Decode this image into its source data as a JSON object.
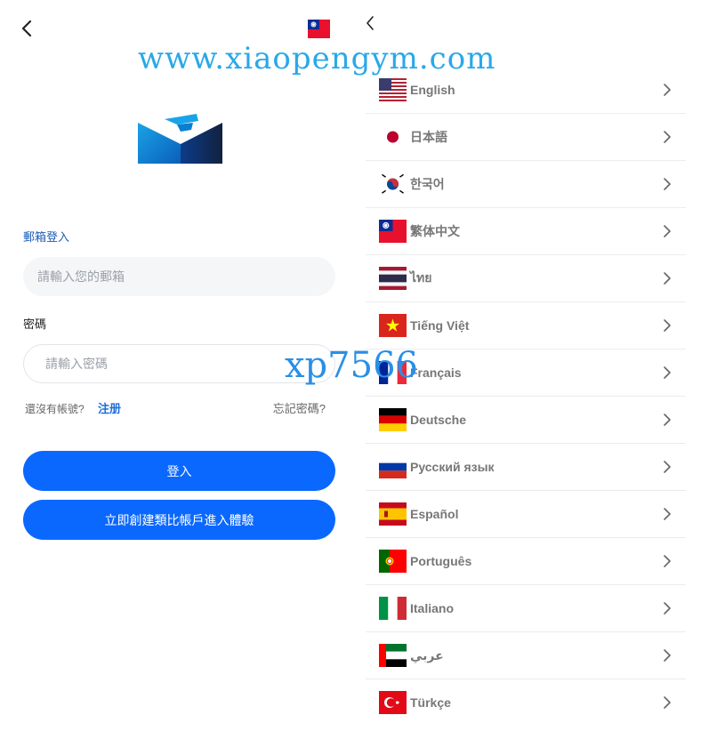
{
  "login": {
    "email_tab_label": "郵箱登入",
    "email_placeholder": "請輸入您的郵箱",
    "email_value": "",
    "password_label": "密碼",
    "password_placeholder": "請輸入密碼",
    "password_value": "",
    "no_account_text": "還沒有帳號?",
    "register_link": "注册",
    "forgot_link": "忘記密碼?",
    "login_button": "登入",
    "demo_button": "立即創建類比帳戶進入體驗",
    "current_flag": "taiwan-flag"
  },
  "languages": {
    "items": [
      {
        "label": "English",
        "flag": "usa-flag"
      },
      {
        "label": "日本語",
        "flag": "japan-flag"
      },
      {
        "label": "한국어",
        "flag": "korea-flag"
      },
      {
        "label": "繁体中文",
        "flag": "taiwan-flag"
      },
      {
        "label": "ไทย",
        "flag": "thailand-flag"
      },
      {
        "label": "Tiếng Việt",
        "flag": "vietnam-flag"
      },
      {
        "label": "Français",
        "flag": "france-flag"
      },
      {
        "label": "Deutsche",
        "flag": "germany-flag"
      },
      {
        "label": "Русский язык",
        "flag": "russia-flag"
      },
      {
        "label": "Español",
        "flag": "spain-flag"
      },
      {
        "label": "Português",
        "flag": "portugal-flag"
      },
      {
        "label": "Italiano",
        "flag": "italy-flag"
      },
      {
        "label": "عربي",
        "flag": "uae-flag"
      },
      {
        "label": "Türkçe",
        "flag": "turkey-flag"
      }
    ]
  },
  "watermarks": {
    "top": "www.xiaopengym.com",
    "middle": "xp7566"
  },
  "colors": {
    "primary_button": "#0a68ff",
    "link_blue": "#1e6fd9",
    "email_tab_blue": "#1e5db8",
    "watermark_blue": "#29a8e8"
  }
}
